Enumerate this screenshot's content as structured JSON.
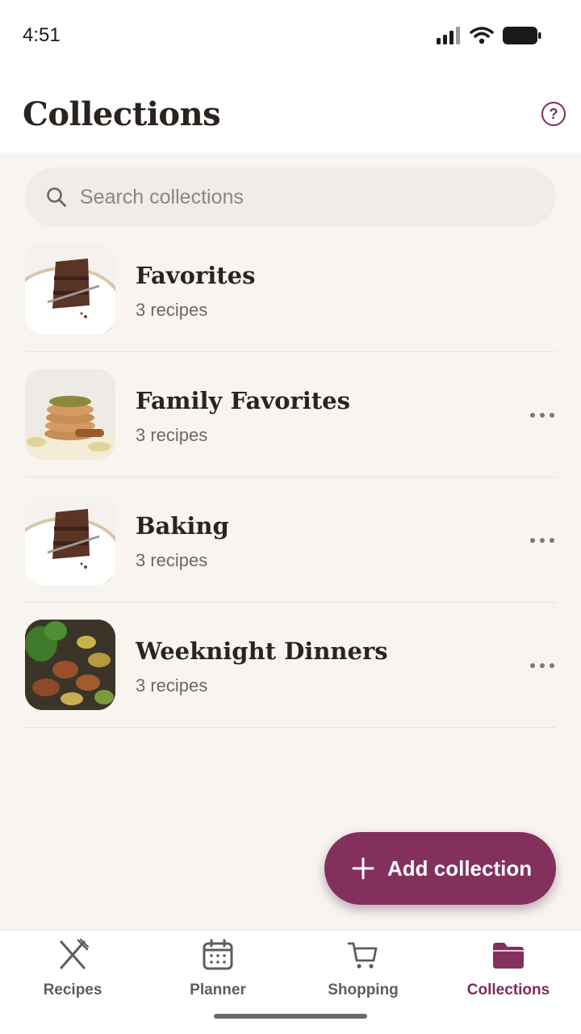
{
  "status_bar": {
    "time": "4:51"
  },
  "header": {
    "title": "Collections",
    "help_glyph": "?"
  },
  "search": {
    "placeholder": "Search collections",
    "value": ""
  },
  "collections": [
    {
      "title": "Favorites",
      "count": "3 recipes",
      "thumbnail": "chocolate-cake",
      "has_menu": false
    },
    {
      "title": "Family Favorites",
      "count": "3 recipes",
      "thumbnail": "pancake-stack",
      "has_menu": true
    },
    {
      "title": "Baking",
      "count": "3 recipes",
      "thumbnail": "chocolate-cake",
      "has_menu": true
    },
    {
      "title": "Weeknight Dinners",
      "count": "3 recipes",
      "thumbnail": "roasted-vegetables",
      "has_menu": true
    }
  ],
  "fab": {
    "label": "Add collection",
    "icon": "plus-icon"
  },
  "bottom_nav": {
    "active": "Collections",
    "items": [
      {
        "label": "Recipes",
        "icon": "utensils-icon"
      },
      {
        "label": "Planner",
        "icon": "calendar-icon"
      },
      {
        "label": "Shopping",
        "icon": "cart-icon"
      },
      {
        "label": "Collections",
        "icon": "folder-icon"
      }
    ]
  },
  "colors": {
    "accent": "#84305f",
    "background": "#f8f5f1",
    "text": "#2b2320",
    "muted": "#6e6762"
  }
}
